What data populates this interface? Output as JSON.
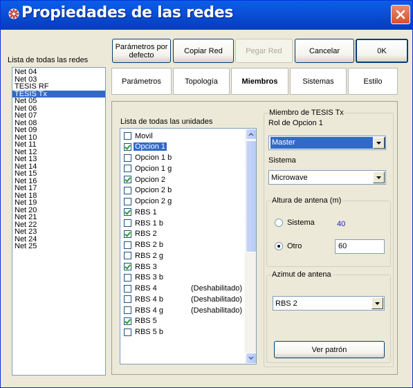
{
  "window": {
    "title": "Propiedades de las redes",
    "icon": "network-app-icon",
    "close_icon": "close-icon"
  },
  "left_panel": {
    "label": "Lista de todas las redes",
    "networks": [
      "Net 04",
      "Net 03",
      "TESIS RF",
      "TESIS Tx",
      "Net 05",
      "Net 06",
      "Net 07",
      "Net 08",
      "Net 09",
      "Net 10",
      "Net 11",
      "Net 12",
      "Net 13",
      "Net 14",
      "Net 15",
      "Net 16",
      "Net 17",
      "Net 18",
      "Net 19",
      "Net 20",
      "Net 21",
      "Net 22",
      "Net 23",
      "Net 24",
      "Net 25"
    ],
    "selected": "TESIS Tx"
  },
  "toolbar": {
    "defaults": "Parámetros por defecto",
    "copy": "Copiar Red",
    "paste": "Pegar Red",
    "cancel": "Cancelar",
    "ok": "0K"
  },
  "tabs": [
    "Parámetros",
    "Topología",
    "Miembros",
    "Sistemas",
    "Estilo"
  ],
  "active_tab": "Miembros",
  "members": {
    "units_label": "Lista de todas las unidades",
    "units": [
      {
        "name": "Movil",
        "checked": false,
        "note": ""
      },
      {
        "name": "Opcion 1",
        "checked": true,
        "note": "",
        "selected": true
      },
      {
        "name": "Opcion 1 b",
        "checked": false,
        "note": ""
      },
      {
        "name": "Opcion 1 g",
        "checked": false,
        "note": ""
      },
      {
        "name": "Opcion 2",
        "checked": true,
        "note": ""
      },
      {
        "name": "Opcion 2 b",
        "checked": false,
        "note": ""
      },
      {
        "name": "Opcion 2 g",
        "checked": false,
        "note": ""
      },
      {
        "name": "RBS 1",
        "checked": true,
        "note": ""
      },
      {
        "name": "RBS 1 b",
        "checked": false,
        "note": ""
      },
      {
        "name": "RBS 2",
        "checked": true,
        "note": ""
      },
      {
        "name": "RBS 2 b",
        "checked": false,
        "note": ""
      },
      {
        "name": "RBS 2 g",
        "checked": false,
        "note": ""
      },
      {
        "name": "RBS 3",
        "checked": true,
        "note": ""
      },
      {
        "name": "RBS 3 b",
        "checked": false,
        "note": ""
      },
      {
        "name": "RBS 4",
        "checked": false,
        "note": "(Deshabilitado)"
      },
      {
        "name": "RBS 4 b",
        "checked": false,
        "note": "(Deshabilitado)"
      },
      {
        "name": "RBS 4 g",
        "checked": false,
        "note": "(Deshabilitado)"
      },
      {
        "name": "RBS 5",
        "checked": true,
        "note": ""
      },
      {
        "name": "RBS 5 b",
        "checked": false,
        "note": ""
      }
    ],
    "member_group_title": "Miembro de TESIS Tx",
    "role_label": "Rol de Opcion 1",
    "role_value": "Master",
    "system_label": "Sistema",
    "system_value": "Microwave",
    "antenna_height_title": "Altura de antena (m)",
    "radio_system_label": "Sistema",
    "radio_system_value": "40",
    "radio_other_label": "Otro",
    "radio_other_value": "60",
    "azimuth_title": "Azimut de antena",
    "azimuth_value": "RBS 2",
    "pattern_button": "Ver patrón"
  },
  "colors": {
    "title_bar": "#0b4fd6",
    "selection": "#316ac5",
    "check": "#21a121",
    "value_text": "#2323b5"
  }
}
